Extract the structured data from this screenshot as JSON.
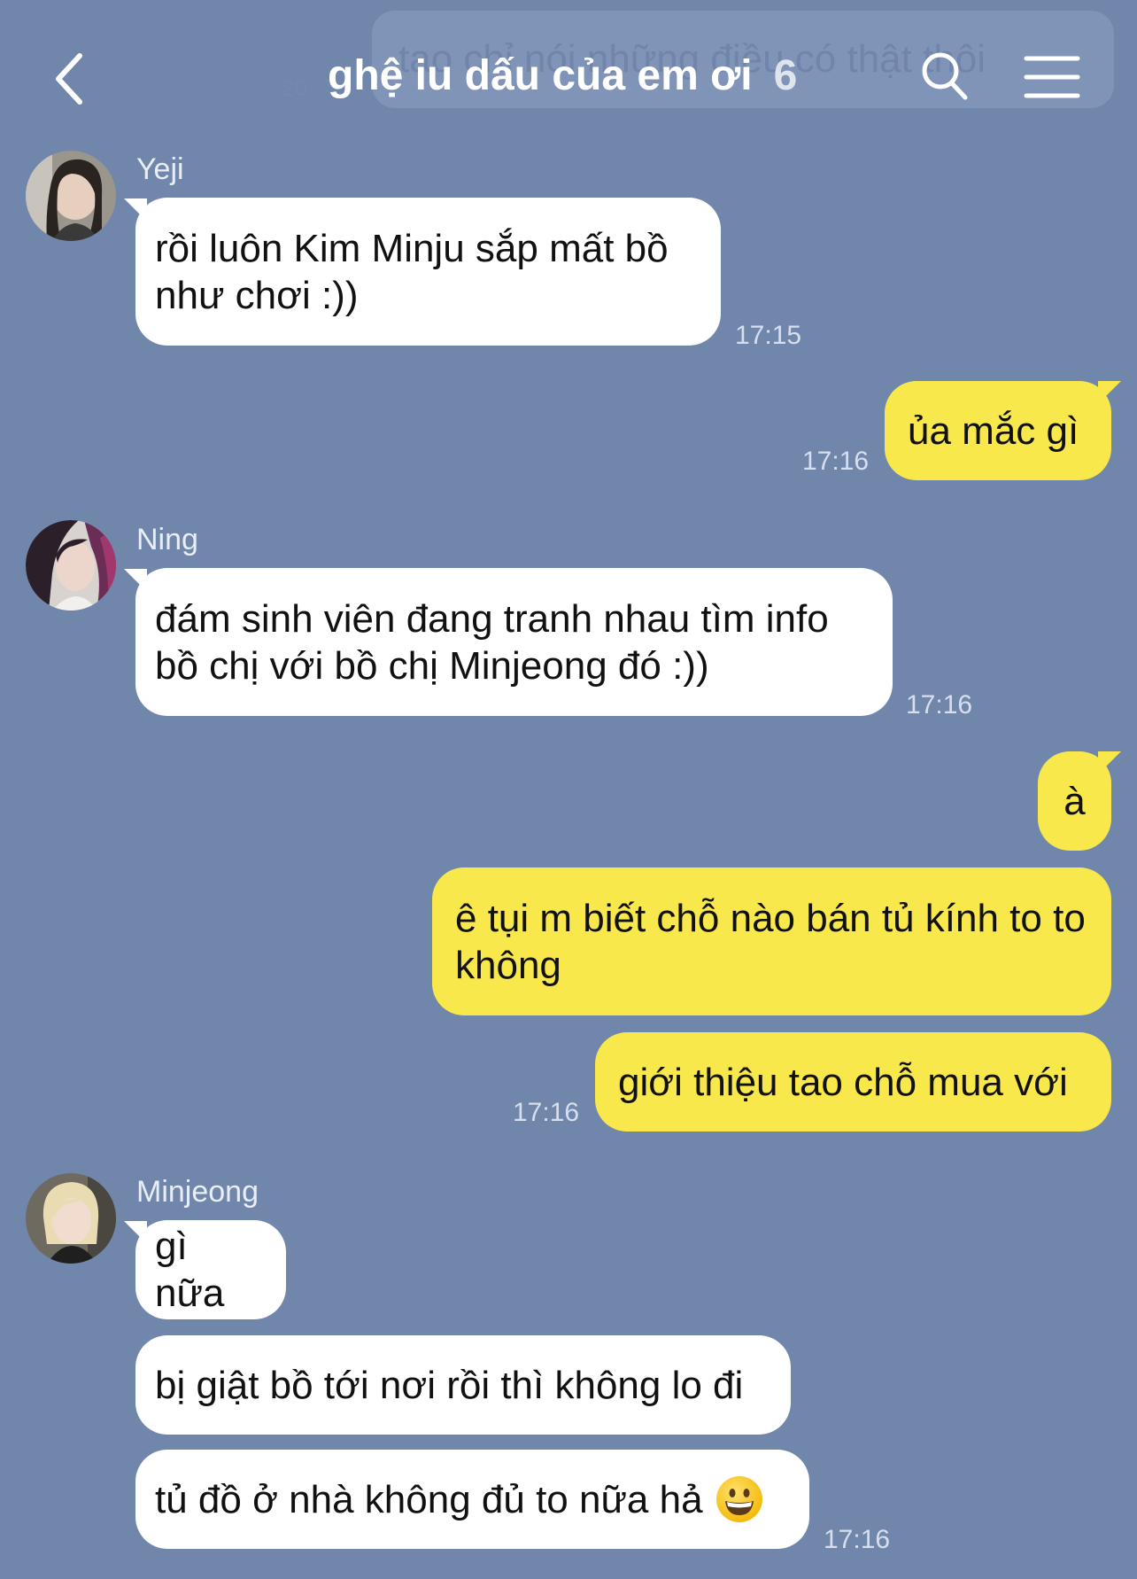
{
  "pinned": {
    "text": "tao chỉ nói những điều có thật thôi",
    "date": "20"
  },
  "header": {
    "title": "ghệ iu dấu của em ơi",
    "member_count": "6"
  },
  "messages": [
    {
      "sender": "Yeji",
      "text": "rồi luôn Kim Minju sắp mất bồ như chơi :))",
      "time": "17:15"
    },
    {
      "out": true,
      "text": "ủa mắc gì",
      "time": "17:16"
    },
    {
      "sender": "Ning",
      "text": "đám sinh viên đang tranh nhau tìm info bồ chị với bồ chị Minjeong đó :))",
      "time": "17:16"
    },
    {
      "out": true,
      "text": "à"
    },
    {
      "out": true,
      "text": "ê tụi m biết chỗ nào bán tủ kính to to không"
    },
    {
      "out": true,
      "text": "giới thiệu tao chỗ mua với",
      "time": "17:16"
    },
    {
      "sender": "Minjeong",
      "text": "gì nữa"
    },
    {
      "text": "bị giật bồ tới nơi rồi thì không lo đi"
    },
    {
      "text": "tủ đồ ở nhà không đủ to nữa hả",
      "emoji": "grinning-face",
      "time": "17:16"
    }
  ],
  "colors": {
    "background": "#7186ab",
    "outgoing": "#f8e84c",
    "incoming": "#ffffff"
  }
}
